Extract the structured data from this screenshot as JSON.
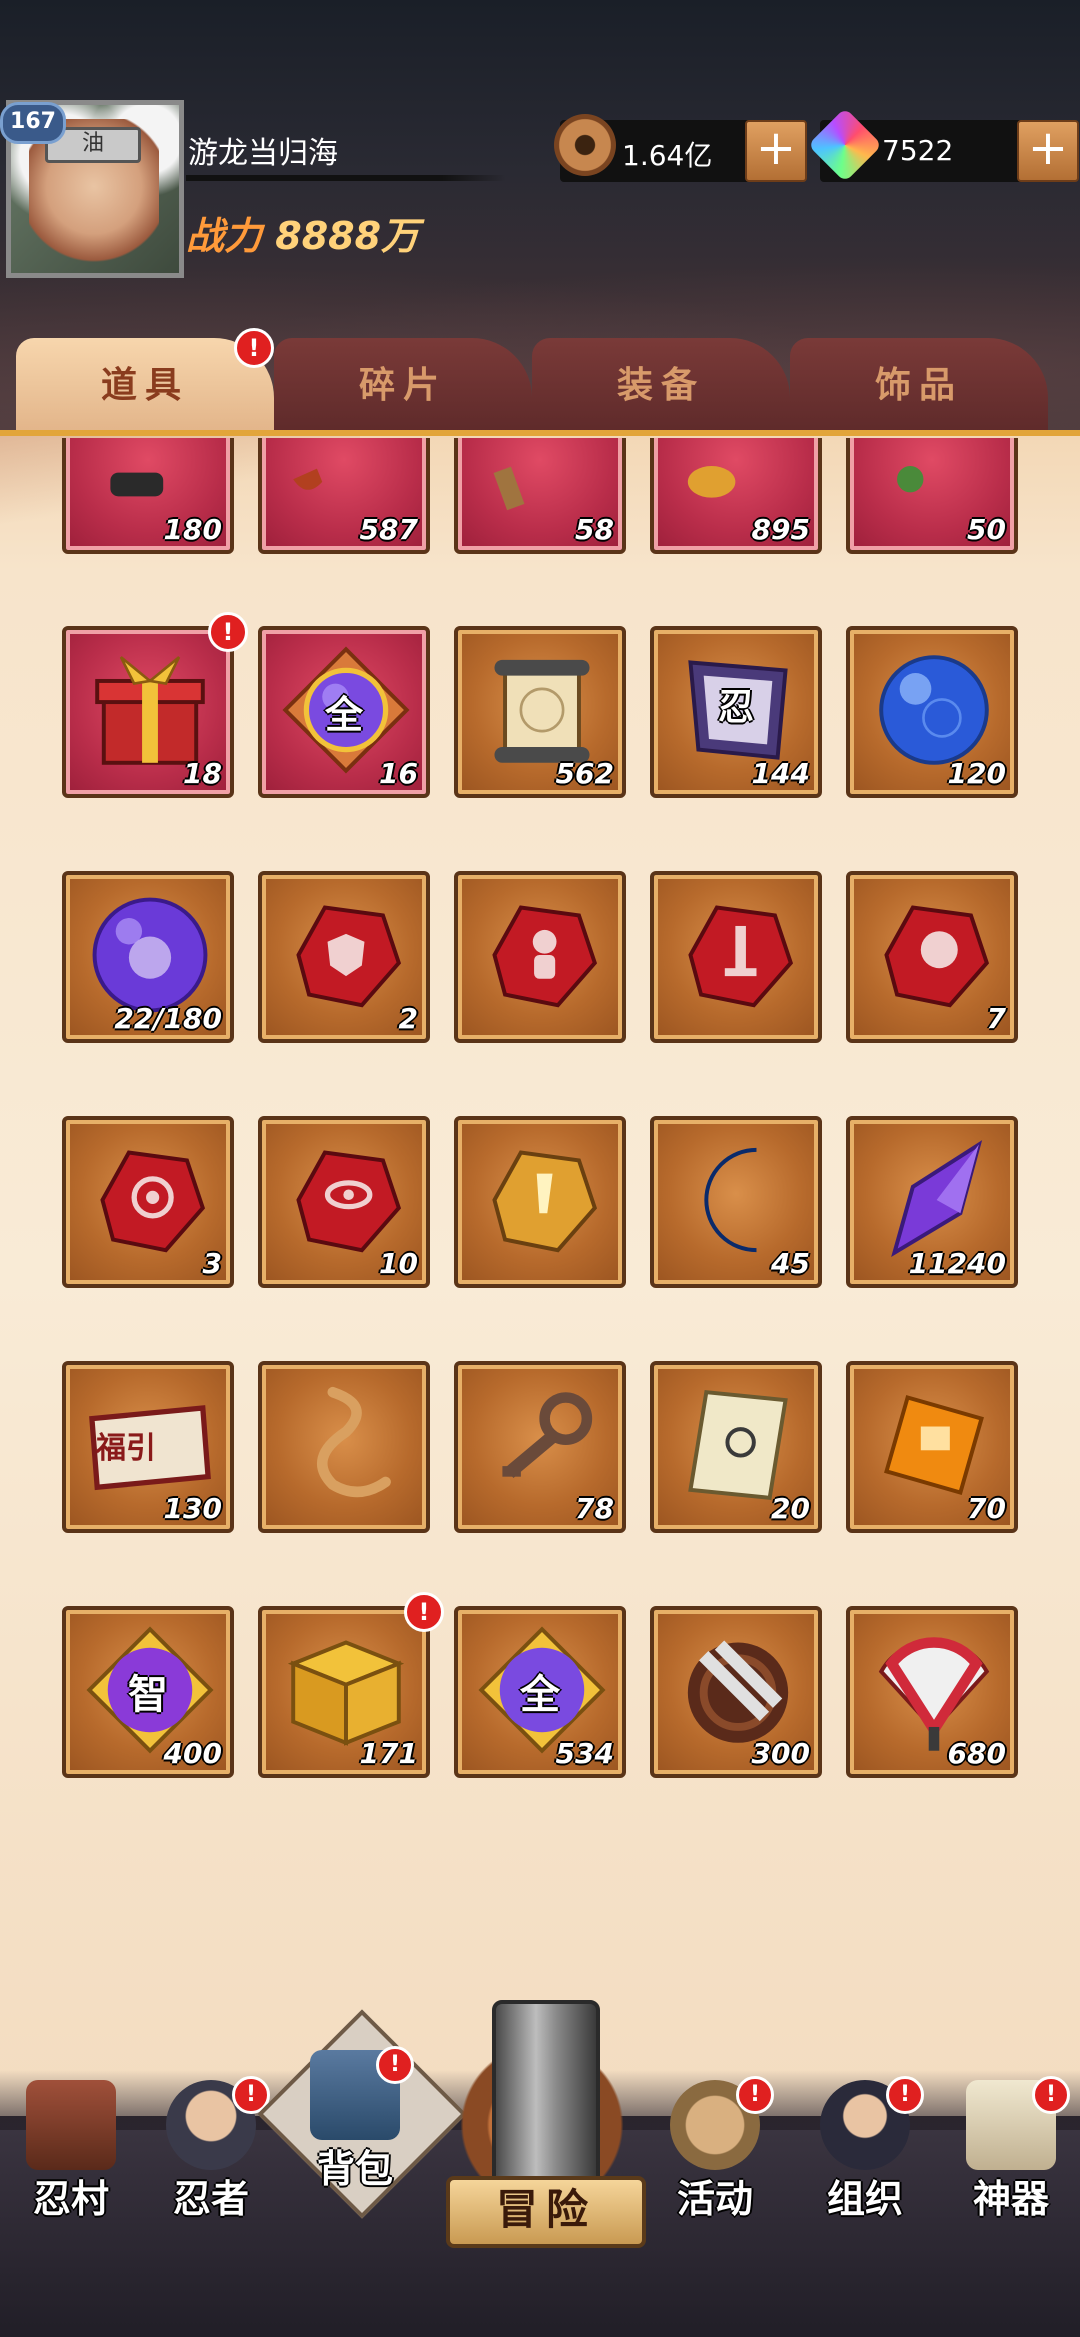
{
  "player": {
    "level": "167",
    "name": "游龙当归海",
    "power_label": "战力",
    "power_value": "8888万",
    "headband_glyph": "油"
  },
  "currency": {
    "copper": "1.64亿",
    "gems": "7522",
    "plus": "+"
  },
  "tabs": [
    {
      "label": "道具",
      "active": true,
      "alert": "!"
    },
    {
      "label": "碎片",
      "active": false
    },
    {
      "label": "装备",
      "active": false
    },
    {
      "label": "饰品",
      "active": false
    }
  ],
  "items": {
    "row0": [
      {
        "icon": "scroll-tube-icon",
        "count": "180",
        "style": "red"
      },
      {
        "icon": "red-pouch-icon",
        "count": "587",
        "style": "red"
      },
      {
        "icon": "wooden-stick-icon",
        "count": "58",
        "style": "red"
      },
      {
        "icon": "gold-bag-icon",
        "count": "895",
        "style": "red"
      },
      {
        "icon": "green-item-icon",
        "count": "50",
        "style": "red"
      }
    ],
    "row1": [
      {
        "icon": "gift-box-icon",
        "count": "18",
        "style": "red",
        "alert": "!"
      },
      {
        "icon": "all-orb-icon",
        "count": "16",
        "style": "red",
        "glyph": "全"
      },
      {
        "icon": "parchment-scroll-icon",
        "count": "562"
      },
      {
        "icon": "ninja-banner-icon",
        "count": "144",
        "glyph": "忍"
      },
      {
        "icon": "blue-orb-icon",
        "count": "120"
      }
    ],
    "row2": [
      {
        "icon": "purple-orb-icon",
        "count": "22/180"
      },
      {
        "icon": "red-stone-shield-icon",
        "count": "2"
      },
      {
        "icon": "red-stone-figure-icon",
        "count": ""
      },
      {
        "icon": "red-stone-sword-icon",
        "count": ""
      },
      {
        "icon": "red-stone-fist-icon",
        "count": "7"
      }
    ],
    "row3": [
      {
        "icon": "red-stone-target-icon",
        "count": "3"
      },
      {
        "icon": "red-stone-eye-icon",
        "count": "10"
      },
      {
        "icon": "gold-stone-icon",
        "count": ""
      },
      {
        "icon": "blue-moon-icon",
        "count": "45"
      },
      {
        "icon": "purple-crystal-icon",
        "count": "11240"
      }
    ],
    "row4": [
      {
        "icon": "fortune-ticket-icon",
        "count": "130",
        "glyph": "福引"
      },
      {
        "icon": "rope-icon",
        "count": ""
      },
      {
        "icon": "key-icon",
        "count": "78"
      },
      {
        "icon": "seal-paper-icon",
        "count": "20"
      },
      {
        "icon": "amber-gem-icon",
        "count": "70"
      }
    ],
    "row5": [
      {
        "icon": "wisdom-orb-icon",
        "count": "400",
        "glyph": "智"
      },
      {
        "icon": "gold-box-icon",
        "count": "171",
        "alert": "!"
      },
      {
        "icon": "all-orb-icon",
        "count": "534",
        "glyph": "全"
      },
      {
        "icon": "tornado-scroll-icon",
        "count": "300"
      },
      {
        "icon": "war-fan-icon",
        "count": "680"
      }
    ]
  },
  "nav": [
    {
      "label": "忍村",
      "alert": ""
    },
    {
      "label": "忍者",
      "alert": "!"
    },
    {
      "label": "背包",
      "alert": "!"
    },
    {
      "label": "冒险",
      "alert": ""
    },
    {
      "label": "活动",
      "alert": "!"
    },
    {
      "label": "组织",
      "alert": "!"
    },
    {
      "label": "神器",
      "alert": "!"
    }
  ]
}
